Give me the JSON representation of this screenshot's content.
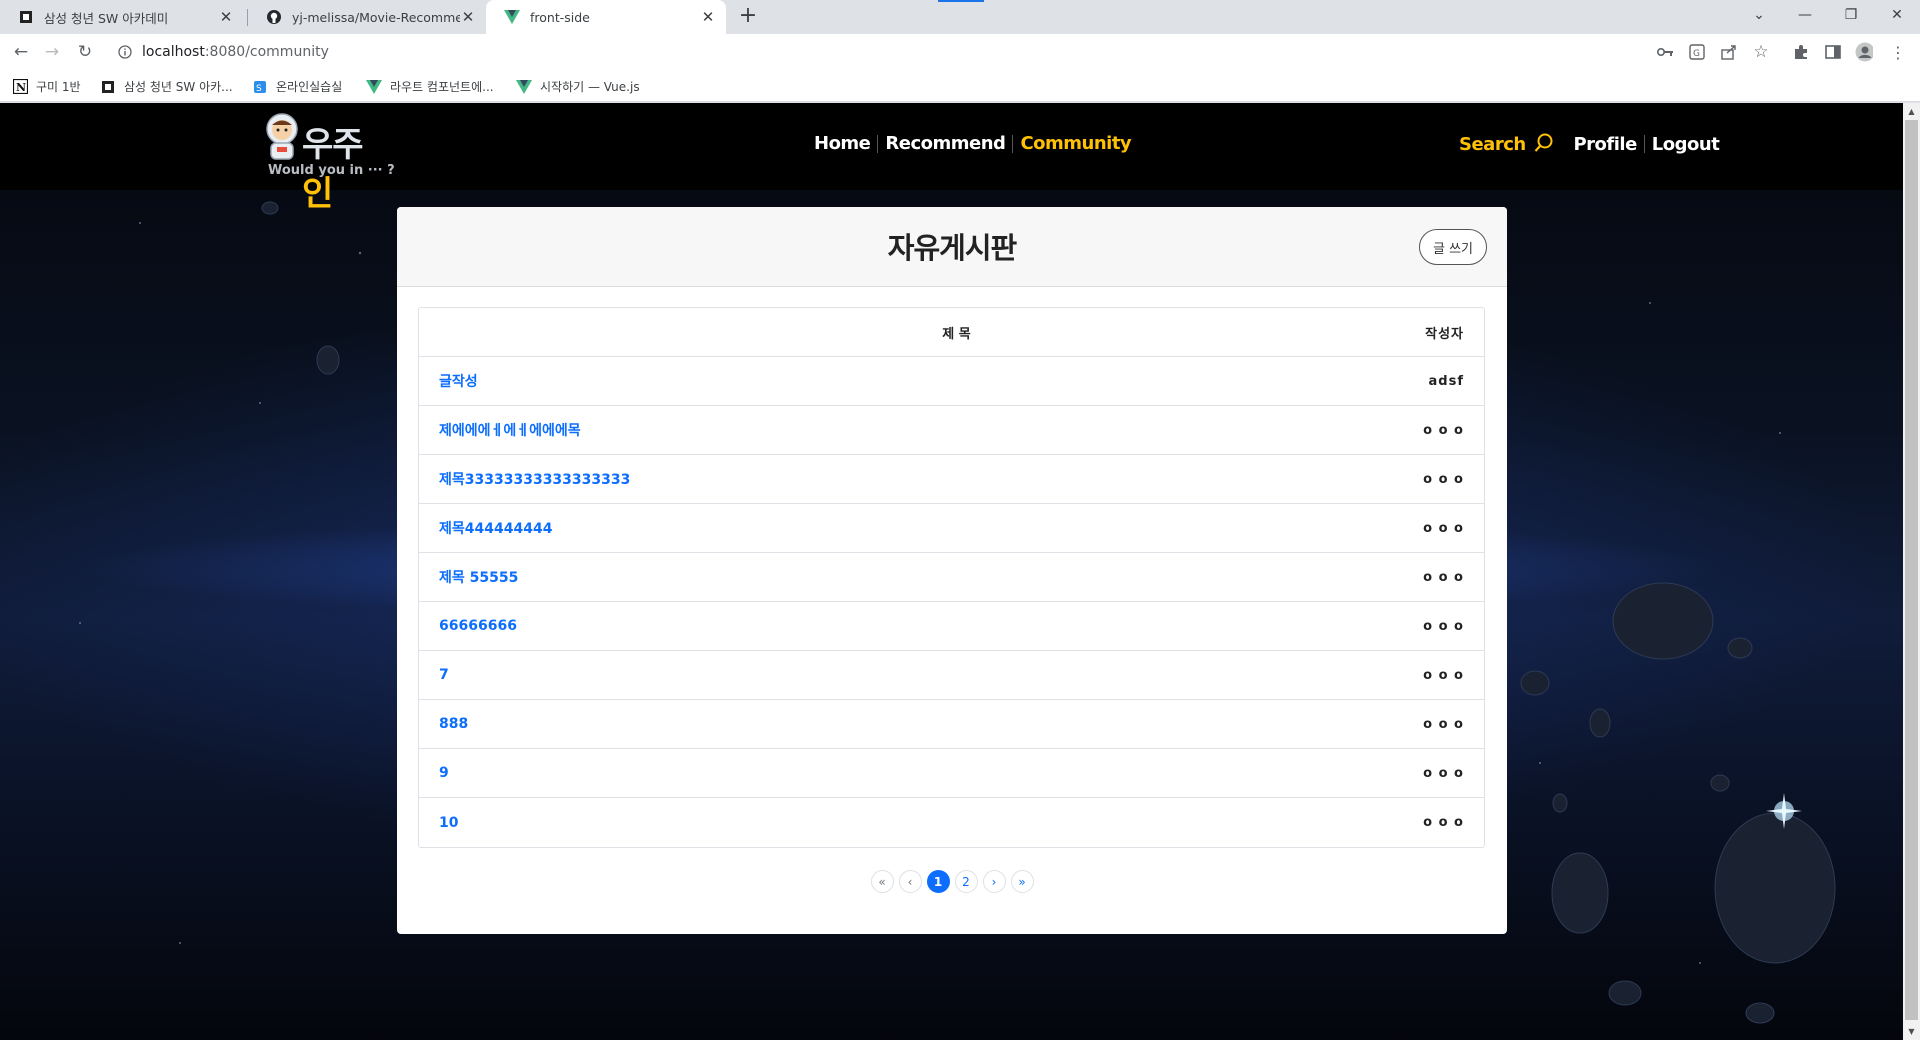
{
  "browser": {
    "tabs": [
      {
        "title": "삼성 청년 SW 아카데미",
        "active": false
      },
      {
        "title": "yj-melissa/Movie-Recommend-",
        "active": false
      },
      {
        "title": "front-side",
        "active": true
      }
    ],
    "url_host": "localhost",
    "url_path": ":8080/community",
    "bookmarks": [
      {
        "label": "구미 1반"
      },
      {
        "label": "삼성 청년 SW 아카..."
      },
      {
        "label": "온라인실습실"
      },
      {
        "label": "라우트 컴포넌트에..."
      },
      {
        "label": "시작하기 — Vue.js"
      }
    ]
  },
  "site": {
    "logo_main": "우주",
    "logo_accent": "인",
    "logo_sub": "Would you in ··· ?",
    "nav": {
      "home": "Home",
      "recommend": "Recommend",
      "community": "Community"
    },
    "right_nav": {
      "search": "Search",
      "profile": "Profile",
      "logout": "Logout"
    },
    "colors": {
      "accent": "#ffc107",
      "link": "#0d6efd"
    }
  },
  "board": {
    "title": "자유게시판",
    "write_button": "글 쓰기",
    "columns": {
      "title": "제 목",
      "author": "작성자"
    },
    "rows": [
      {
        "title": "글작성",
        "author": "adsf"
      },
      {
        "title": "제에에에ㅔ에ㅔ에에에목",
        "author": "o o o"
      },
      {
        "title": "제목33333333333333333",
        "author": "o o o"
      },
      {
        "title": "제목444444444",
        "author": "o o o"
      },
      {
        "title": "제목 55555",
        "author": "o o o"
      },
      {
        "title": "66666666",
        "author": "o o o"
      },
      {
        "title": "7",
        "author": "o o o"
      },
      {
        "title": "888",
        "author": "o o o"
      },
      {
        "title": "9",
        "author": "o o o"
      },
      {
        "title": "10",
        "author": "o o o"
      }
    ],
    "pagination": {
      "first": "«",
      "prev": "‹",
      "pages": [
        "1",
        "2"
      ],
      "current": "1",
      "next": "›",
      "last": "»"
    }
  }
}
